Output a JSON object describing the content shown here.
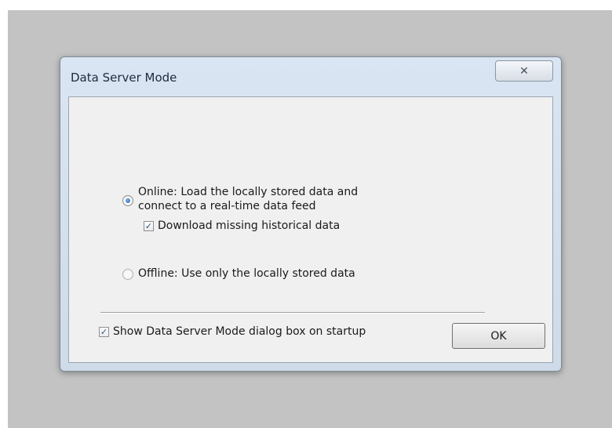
{
  "dialog": {
    "title": "Data Server Mode",
    "close_glyph": "✕",
    "online_option": {
      "line1": "Online: Load the locally stored data and",
      "line2": "connect to a real-time data feed",
      "selected": true
    },
    "download_missing": {
      "label": "Download missing historical data",
      "checked": true
    },
    "offline_option": {
      "label": "Offline: Use only the locally stored data",
      "selected": false
    },
    "show_on_startup": {
      "label": "Show Data Server Mode dialog box on startup",
      "checked": true
    },
    "ok_label": "OK"
  },
  "icons": {
    "close": "close-icon",
    "check": "checkmark-icon"
  },
  "check_glyph": "✓"
}
